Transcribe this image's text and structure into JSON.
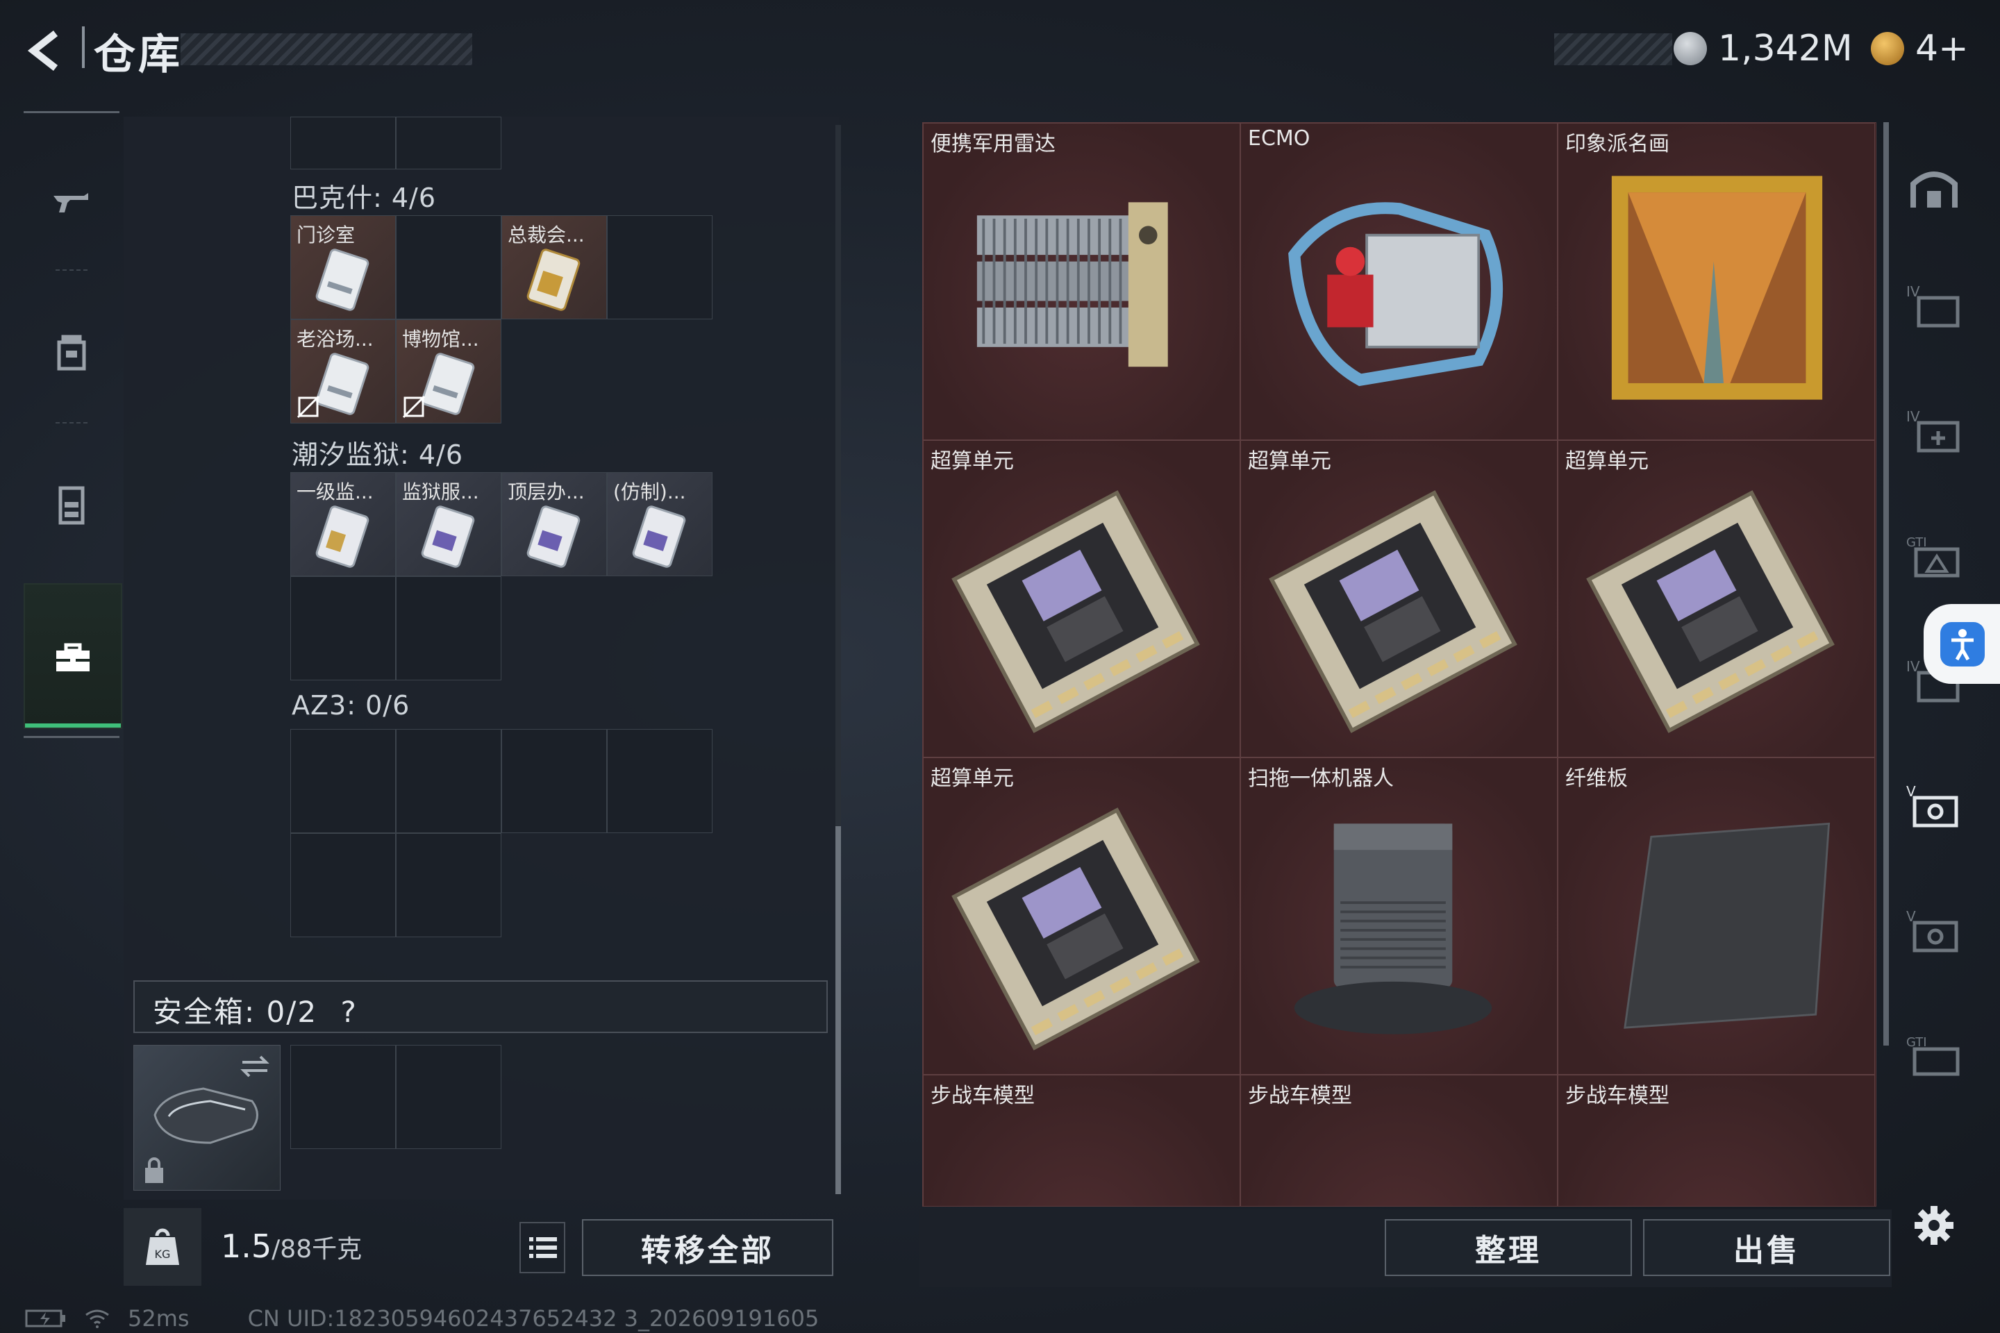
{
  "header": {
    "title": "仓库",
    "currency_primary": "1,342M",
    "currency_secondary": "4+"
  },
  "left_rail": [
    {
      "name": "weapons-tab"
    },
    {
      "name": "backpack-tab"
    },
    {
      "name": "vest-tab"
    },
    {
      "name": "case-tab",
      "active": true
    }
  ],
  "sections": [
    {
      "title": "巴克什: 4/6",
      "cards": [
        {
          "label": "门诊室",
          "locked": false
        },
        {
          "label": "",
          "empty": true
        },
        {
          "label": "总裁会...",
          "locked": false,
          "gold": true
        },
        {
          "label": "",
          "empty": true
        },
        {
          "label": "老浴场...",
          "locked": true
        },
        {
          "label": "博物馆...",
          "locked": true
        }
      ]
    },
    {
      "title": "潮汐监狱: 4/6",
      "cards": [
        {
          "label": "一级监..."
        },
        {
          "label": "监狱服..."
        },
        {
          "label": "顶层办..."
        },
        {
          "label": "(仿制)..."
        }
      ]
    },
    {
      "title": "AZ3: 0/6"
    }
  ],
  "safe_box": {
    "label": "安全箱: 0/2",
    "help": "?"
  },
  "bottom_left": {
    "weight_value": "1.5",
    "weight_max": "/88千克",
    "transfer_all": "转移全部"
  },
  "items": [
    {
      "label": "便携军用雷达",
      "icon": "radar"
    },
    {
      "label": "ECMO",
      "icon": "ecmo"
    },
    {
      "label": "印象派名画",
      "icon": "painting"
    },
    {
      "label": "超算单元",
      "icon": "compute-unit"
    },
    {
      "label": "超算单元",
      "icon": "compute-unit"
    },
    {
      "label": "超算单元",
      "icon": "compute-unit"
    },
    {
      "label": "超算单元",
      "icon": "compute-unit"
    },
    {
      "label": "扫拖一体机器人",
      "icon": "robot-vacuum"
    },
    {
      "label": "纤维板",
      "icon": "fiber-board"
    },
    {
      "label": "步战车模型",
      "icon": "ifv-model"
    },
    {
      "label": "步战车模型",
      "icon": "ifv-model"
    },
    {
      "label": "步战车模型",
      "icon": "ifv-model"
    }
  ],
  "bottom_right": {
    "sort": "整理",
    "sell": "出售"
  },
  "status_bar": {
    "ping": "52ms",
    "uid": "CN UID:18230594602437652432 3_202609191605"
  },
  "colors": {
    "item_bg": "#3a2224",
    "panel_bg": "#1d232b",
    "accent_green": "#3fbf7a",
    "a11y_blue": "#2f7de1"
  }
}
